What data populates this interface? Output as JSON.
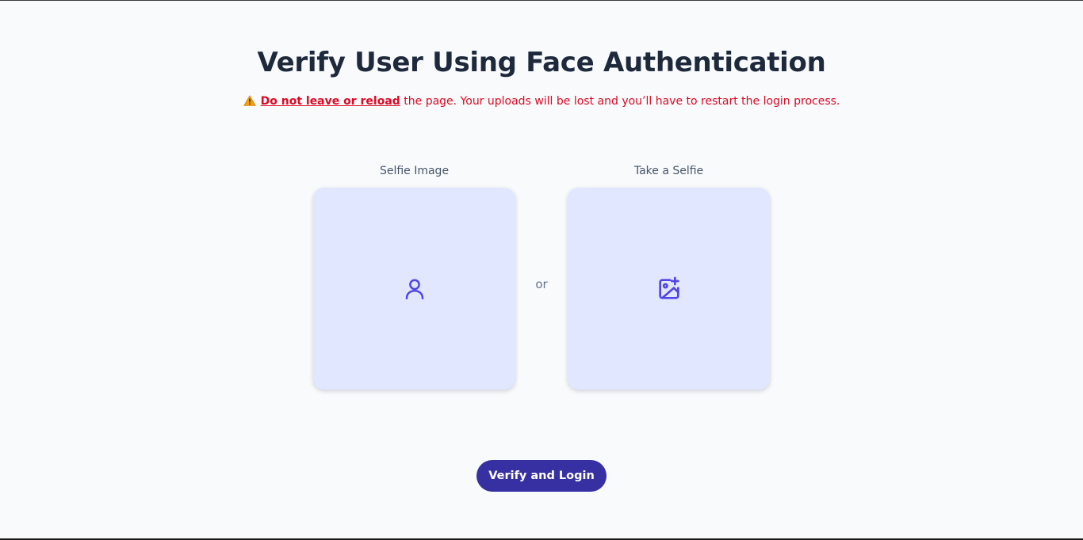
{
  "header": {
    "title": "Verify User Using Face Authentication"
  },
  "warning": {
    "link_text": "Do not leave or reload",
    "message": " the page. Your uploads will be lost and you’ll have to restart the login process.",
    "icon": "warning-triangle-icon",
    "color": "#dc0a24"
  },
  "upload": {
    "selfie_image_label": "Selfie Image",
    "selfie_image_icon": "user-icon",
    "or_text": "or",
    "take_selfie_label": "Take a Selfie",
    "take_selfie_icon": "image-plus-icon",
    "box_color": "#e0e7ff",
    "icon_color": "#4f46e5"
  },
  "actions": {
    "verify_label": "Verify and Login",
    "button_color": "#3730a3"
  }
}
